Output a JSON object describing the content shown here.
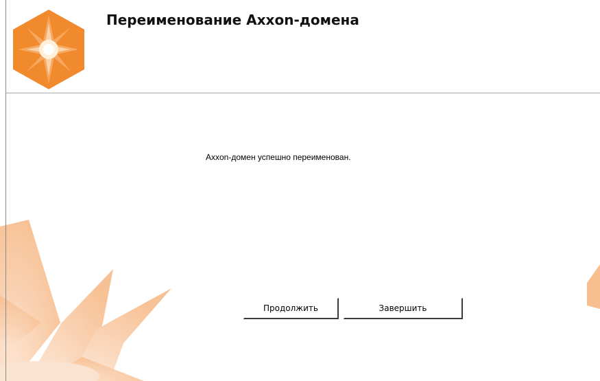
{
  "wizard": {
    "title": "Переименование Axxon-домена",
    "message": "Axxon-домен успешно переименован.",
    "buttons": {
      "continue_label": "Продолжить",
      "finish_label": "Завершить"
    },
    "colors": {
      "accent_orange": "#f08a2c",
      "decor_peach": "#f7c7a0",
      "logo_center": "#fff0dc"
    },
    "icons": {
      "logo": "axxon-star-hexagon-logo"
    }
  }
}
